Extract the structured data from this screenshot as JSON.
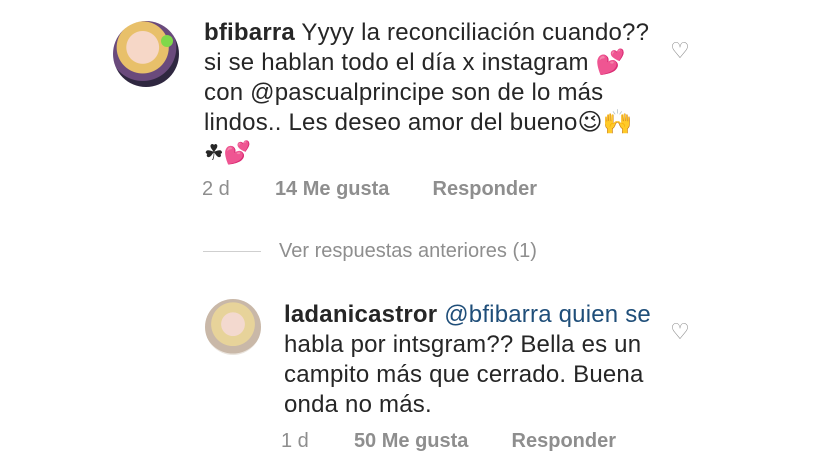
{
  "comments": [
    {
      "username": "bfibarra",
      "lines": [
        "Yyyy la reconciliación cuando??",
        "si se hablan todo el día x instagram 💕",
        "con @pascualprincipe son de lo más",
        "lindos.. Les deseo amor del bueno😉🙌",
        "☘💕"
      ],
      "time": "2 d",
      "likes": "14 Me gusta",
      "reply": "Responder"
    },
    {
      "username": "ladanicastror",
      "lines": [
        "@bfibarra quien se",
        "habla por intsgram?? Bella es un",
        "campito más que cerrado. Buena",
        "onda no más."
      ],
      "time": "1 d",
      "likes": "50 Me gusta",
      "reply": "Responder"
    }
  ],
  "thread": {
    "view_previous": "Ver respuestas anteriores (1)"
  },
  "icons": {
    "like": "heart-outline-icon"
  },
  "colors": {
    "text": "#262626",
    "meta": "#8e8e8e",
    "mention": "#1f4e79"
  }
}
